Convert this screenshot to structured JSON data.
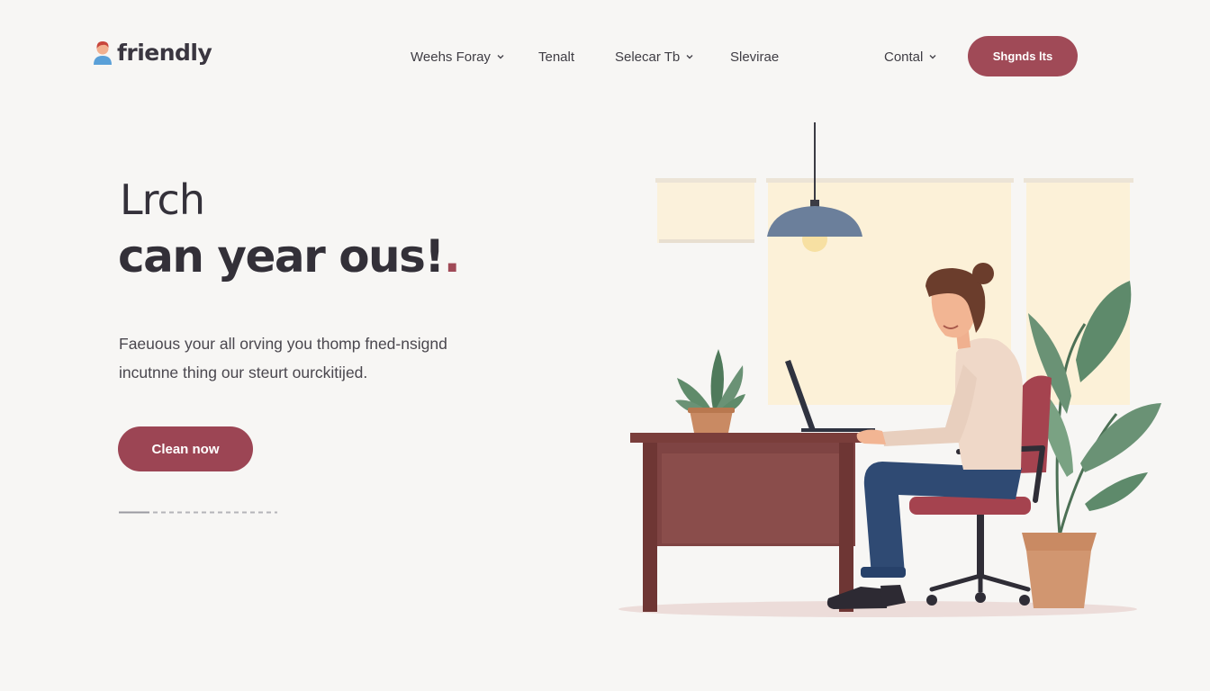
{
  "brand": {
    "name": "friendly",
    "icon": "person-avatar-icon"
  },
  "nav": {
    "items": [
      {
        "label": "Weehs Foray",
        "has_dropdown": true
      },
      {
        "label": "Tenalt",
        "has_dropdown": false
      },
      {
        "label": "Selecar Tb",
        "has_dropdown": true
      },
      {
        "label": "Slevirae",
        "has_dropdown": false
      },
      {
        "label": "Contal",
        "has_dropdown": true
      }
    ],
    "cta_label": "Shgnds lts"
  },
  "hero": {
    "line1": "Lrch",
    "line2": "can year ous!",
    "line2_accent": ".",
    "description": [
      "Faeuous your all orving you thomp fned-nsignd",
      "incutnne thing our steurt ourckitijed."
    ],
    "cta_label": "Clean now"
  },
  "colors": {
    "accent": "#a04a57",
    "background": "#f7f6f4",
    "text": "#34313a"
  },
  "illustration": {
    "subject": "person-working-at-laptop-illustration"
  }
}
